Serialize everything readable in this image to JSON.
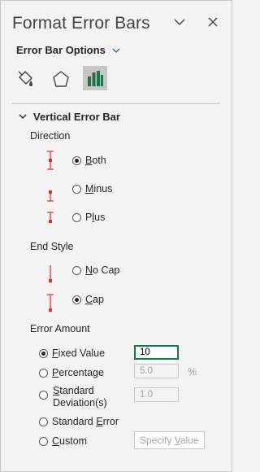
{
  "pane": {
    "title": "Format Error Bars",
    "options_label": "Error Bar Options"
  },
  "icons": {
    "chevron": "chevron-down-icon",
    "close": "close-icon",
    "tabs": [
      "paint-bucket-icon",
      "pentagon-icon",
      "bar-chart-icon"
    ]
  },
  "section": {
    "title": "Vertical Error Bar",
    "direction": {
      "label": "Direction",
      "options": [
        {
          "prefix": "",
          "ul": "B",
          "rest": "oth",
          "checked": true
        },
        {
          "prefix": "",
          "ul": "M",
          "rest": "inus",
          "checked": false
        },
        {
          "prefix": "P",
          "ul": "l",
          "rest": "us",
          "checked": false
        }
      ]
    },
    "end_style": {
      "label": "End Style",
      "options": [
        {
          "prefix": "",
          "ul": "N",
          "rest": "o Cap",
          "checked": false
        },
        {
          "prefix": "",
          "ul": "C",
          "rest": "ap",
          "checked": true
        }
      ]
    },
    "error_amount": {
      "label": "Error Amount",
      "fixed": {
        "prefix": "",
        "ul": "F",
        "rest": "ixed Value",
        "value": "10",
        "checked": true
      },
      "percentage": {
        "prefix": "",
        "ul": "P",
        "rest": "ercentage",
        "value": "5.0",
        "unit": "%"
      },
      "stddev": {
        "line1": "Standard",
        "line2": "Deviation(s)",
        "line1_prefix": "",
        "line1_ul": "S",
        "line1_rest": "tandard",
        "value": "1.0"
      },
      "stderr": {
        "prefix": "Standard ",
        "ul": "E",
        "rest": "rror"
      },
      "custom": {
        "prefix": "",
        "ul": "C",
        "rest": "ustom"
      },
      "specify_button": {
        "prefix": "Specify ",
        "ul": "V",
        "rest": "alue"
      }
    }
  },
  "colors": {
    "accent": "#217346",
    "errorbar": "#e0312a",
    "blue": "#2b6cb0"
  }
}
